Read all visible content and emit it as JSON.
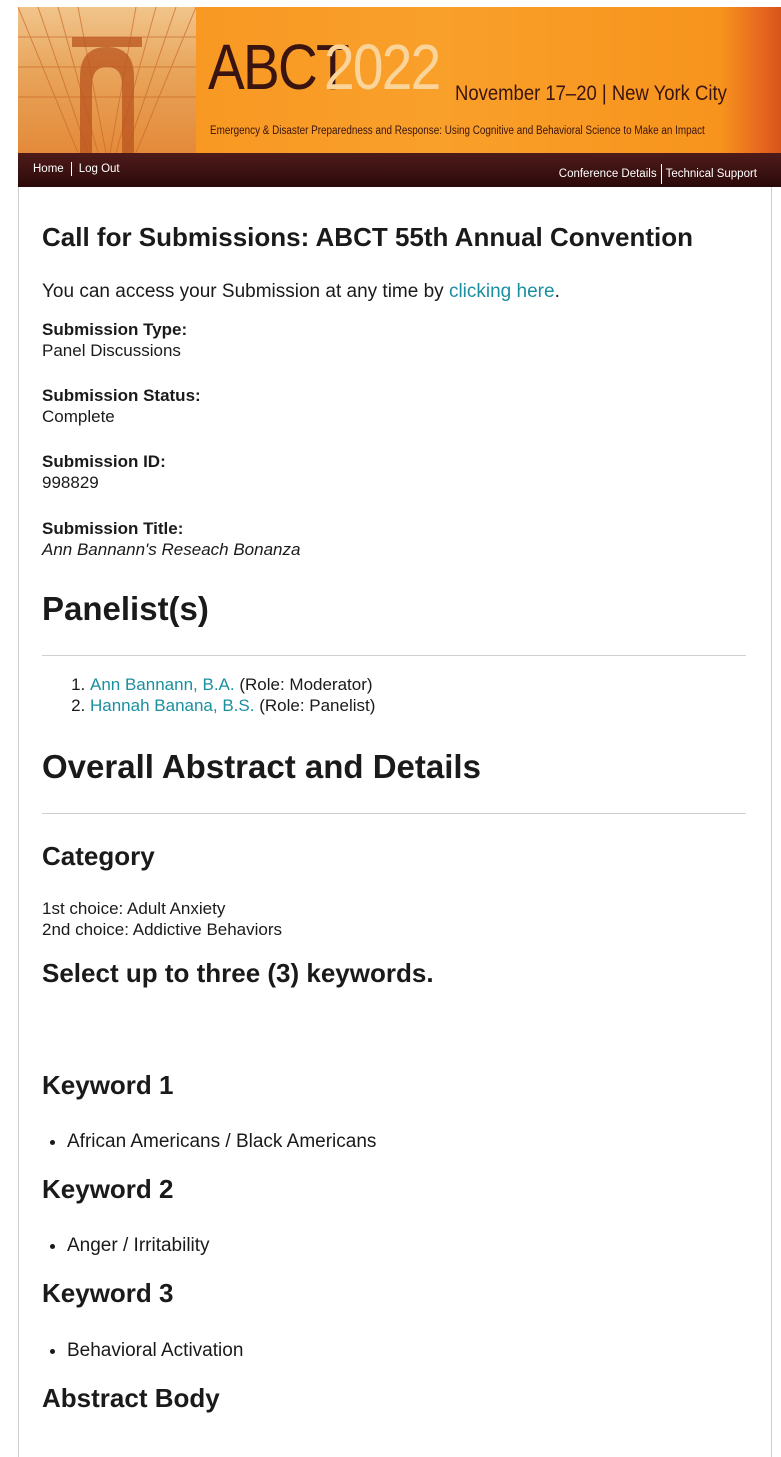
{
  "banner": {
    "abct": "ABCT",
    "year": "2022",
    "dates": "November 17–20 | New York City",
    "theme": "Emergency & Disaster Preparedness and Response: Using Cognitive and Behavioral Science to Make an Impact"
  },
  "nav": {
    "home": "Home",
    "logout": "Log Out",
    "conference_details": "Conference Details",
    "technical_support": "Technical Support"
  },
  "page": {
    "title": "Call for Submissions: ABCT 55th Annual Convention",
    "access_prefix": "You can access your Submission at any time by ",
    "access_link": "clicking here",
    "access_suffix": "."
  },
  "submission": {
    "type_label": "Submission Type:",
    "type_value": "Panel Discussions",
    "status_label": "Submission Status:",
    "status_value": "Complete",
    "id_label": "Submission ID:",
    "id_value": "998829",
    "title_label": "Submission Title:",
    "title_value": "Ann Bannann's Reseach Bonanza"
  },
  "panelists": {
    "heading": "Panelist(s)",
    "items": [
      {
        "name": "Ann Bannann, B.A.",
        "role": " (Role: Moderator)"
      },
      {
        "name": "Hannah Banana, B.S.",
        "role": " (Role: Panelist)"
      }
    ]
  },
  "abstract": {
    "heading": "Overall Abstract and Details",
    "category_heading": "Category",
    "category_first": "1st choice: Adult Anxiety",
    "category_second": "2nd choice: Addictive Behaviors",
    "keywords_heading": "Select up to three (3) keywords.",
    "keyword1_heading": "Keyword 1",
    "keyword1_value": "African Americans / Black Americans",
    "keyword2_heading": "Keyword 2",
    "keyword2_value": "Anger / Irritability",
    "keyword3_heading": "Keyword 3",
    "keyword3_value": "Behavioral Activation",
    "body_heading": "Abstract Body"
  },
  "colors": {
    "banner_orange": "#f7931e",
    "nav_maroon": "#3a0f0e",
    "link_teal": "#1a8fa0"
  }
}
